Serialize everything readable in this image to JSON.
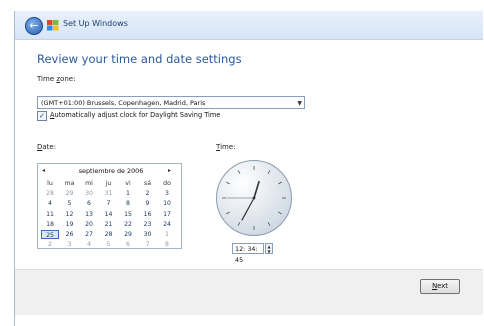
{
  "window": {
    "title": "Set Up Windows"
  },
  "page": {
    "heading": "Review your time and date settings"
  },
  "timezone": {
    "label_prefix": "Time ",
    "label_accel": "z",
    "label_suffix": "one:",
    "value": "(GMT+01:00) Brussels, Copenhagen, Madrid, Paris",
    "dst_checked": true,
    "dst_accel": "A",
    "dst_label": "utomatically adjust clock for Daylight Saving Time"
  },
  "date": {
    "label_accel": "D",
    "label_rest": "ate:",
    "month_label": "septiembre de 2006",
    "prev": "◂",
    "next": "▸",
    "weekdays": [
      "lu",
      "ma",
      "mi",
      "ju",
      "vi",
      "sá",
      "do"
    ],
    "weeks": [
      [
        "28",
        "29",
        "30",
        "31",
        "1",
        "2",
        "3"
      ],
      [
        "4",
        "5",
        "6",
        "7",
        "8",
        "9",
        "10"
      ],
      [
        "11",
        "12",
        "13",
        "14",
        "15",
        "16",
        "17"
      ],
      [
        "18",
        "19",
        "20",
        "21",
        "22",
        "23",
        "24"
      ],
      [
        "25",
        "26",
        "27",
        "28",
        "29",
        "30",
        "1"
      ],
      [
        "2",
        "3",
        "4",
        "5",
        "6",
        "7",
        "8"
      ]
    ],
    "dim_cells": [
      [
        0,
        0
      ],
      [
        0,
        1
      ],
      [
        0,
        2
      ],
      [
        0,
        3
      ],
      [
        4,
        6
      ],
      [
        5,
        0
      ],
      [
        5,
        1
      ],
      [
        5,
        2
      ],
      [
        5,
        3
      ],
      [
        5,
        4
      ],
      [
        5,
        5
      ],
      [
        5,
        6
      ]
    ],
    "selected_cell": [
      4,
      0
    ]
  },
  "time": {
    "label_accel": "T",
    "label_rest": "ime:",
    "value": "12: 34: 45",
    "hours": 12,
    "minutes": 34,
    "seconds": 45
  },
  "footer": {
    "next_accel": "N",
    "next_rest": "ext"
  }
}
